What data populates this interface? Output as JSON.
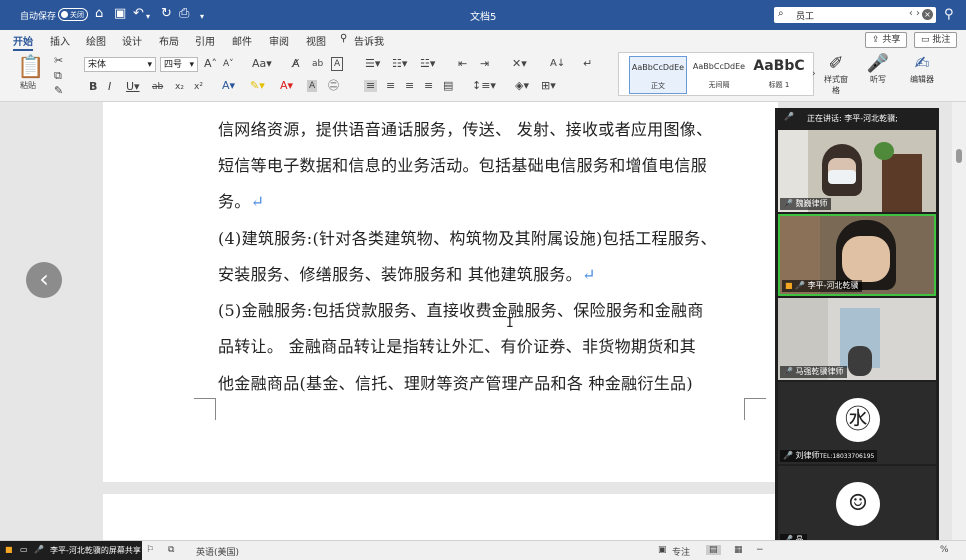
{
  "titlebar": {
    "autosave_label": "自动保存",
    "autosave_state": "关闭",
    "document_title": "文档5",
    "search_value": "员工"
  },
  "ribbon": {
    "tabs": [
      "开始",
      "插入",
      "绘图",
      "设计",
      "布局",
      "引用",
      "邮件",
      "审阅",
      "视图",
      "告诉我"
    ],
    "share_label": "共享",
    "comment_label": "批注",
    "paste_label": "粘贴",
    "font_name": "宋体",
    "font_size": "四号",
    "change_case": "Aa",
    "styles": [
      {
        "preview": "AaBbCcDdEe",
        "name": "正文"
      },
      {
        "preview": "AaBbCcDdEe",
        "name": "无间隔"
      },
      {
        "preview": "AaBbC",
        "name": "标题 1"
      }
    ],
    "styles_pane_label": "样式窗格",
    "dictate_label": "听写",
    "editor_label": "编辑器"
  },
  "document": {
    "lines": [
      "信网络资源，提供语音通话服务，传送、 发射、接收或者应用图像、",
      "短信等电子数据和信息的业务活动。包括基础电信服务和增值电信服",
      "务。",
      "(4)建筑服务:(针对各类建筑物、构筑物及其附属设施)包括工程服务、",
      "安装服务、修缮服务、装饰服务和 其他建筑服务。",
      "(5)金融服务:包括贷款服务、直接收费金融服务、保险服务和金融商",
      "品转让。 金融商品转让是指转让外汇、有价证券、非货物期货和其",
      "他金融商品(基金、信托、理财等资产管理产品和各 种金融衍生品)"
    ],
    "paragraph_mark": "↵"
  },
  "meeting": {
    "speaking_label": "正在讲话: 李平-河北乾骥;",
    "participants": [
      {
        "name": "魏巍律师"
      },
      {
        "name": "李平-河北乾骥"
      },
      {
        "name": "马强乾骥律师"
      },
      {
        "name": "刘律师",
        "phone": "TEL:18033706195"
      },
      {
        "name": "晶"
      }
    ]
  },
  "statusbar": {
    "share_text": "李平-河北乾骥的屏幕共享",
    "language": "英语(美国)",
    "focus_label": "专注",
    "zoom_suffix": "%"
  }
}
